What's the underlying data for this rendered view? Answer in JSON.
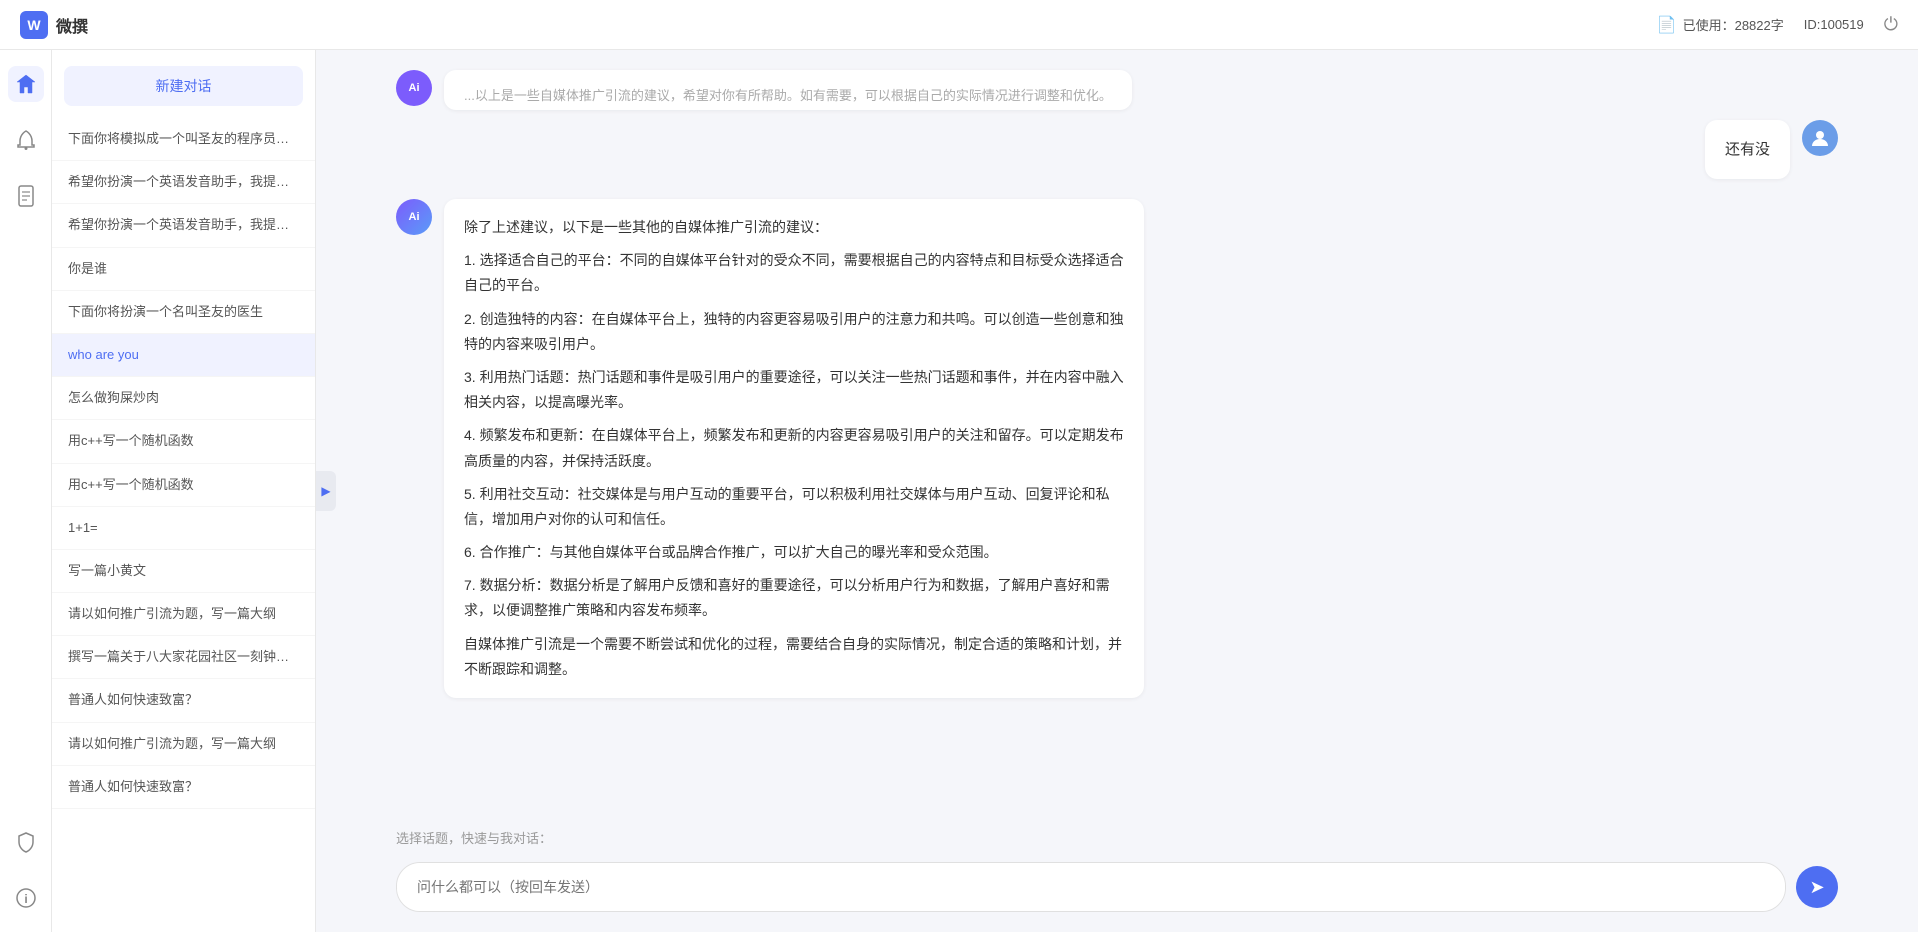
{
  "topbar": {
    "logo_text": "W",
    "title": "微撰",
    "char_label": "已使用：28822字",
    "user_id": "ID:100519",
    "char_icon": "📄"
  },
  "sidebar": {
    "new_chat_label": "新建对话",
    "history": [
      {
        "id": 1,
        "text": "下面你将模拟成一个叫圣友的程序员，我说...",
        "active": false
      },
      {
        "id": 2,
        "text": "希望你扮演一个英语发音助手，我提供给你...",
        "active": false
      },
      {
        "id": 3,
        "text": "希望你扮演一个英语发音助手，我提供给你...",
        "active": false
      },
      {
        "id": 4,
        "text": "你是谁",
        "active": false
      },
      {
        "id": 5,
        "text": "下面你将扮演一个名叫圣友的医生",
        "active": false
      },
      {
        "id": 6,
        "text": "who are you",
        "active": true
      },
      {
        "id": 7,
        "text": "怎么做狗屎炒肉",
        "active": false
      },
      {
        "id": 8,
        "text": "用c++写一个随机函数",
        "active": false
      },
      {
        "id": 9,
        "text": "用c++写一个随机函数",
        "active": false
      },
      {
        "id": 10,
        "text": "1+1=",
        "active": false
      },
      {
        "id": 11,
        "text": "写一篇小黄文",
        "active": false
      },
      {
        "id": 12,
        "text": "请以如何推广引流为题，写一篇大纲",
        "active": false
      },
      {
        "id": 13,
        "text": "撰写一篇关于八大家花园社区一刻钟便民生...",
        "active": false
      },
      {
        "id": 14,
        "text": "普通人如何快速致富？",
        "active": false
      },
      {
        "id": 15,
        "text": "请以如何推广引流为题，写一篇大纲",
        "active": false
      },
      {
        "id": 16,
        "text": "普通人如何快速致富？",
        "active": false
      }
    ],
    "bottom_items": [
      "安全",
      "关于"
    ]
  },
  "icons": {
    "collapse": "▶",
    "nav1": "⬡",
    "nav2": "🔔",
    "nav3": "📝",
    "bottom1": "🔒",
    "bottom2": "ℹ"
  },
  "chat": {
    "messages": [
      {
        "role": "user",
        "text": "还有没",
        "avatar_text": "U"
      },
      {
        "role": "ai",
        "avatar_text": "Ai",
        "paragraphs": [
          "除了上述建议，以下是一些其他的自媒体推广引流的建议：",
          "1. 选择适合自己的平台：不同的自媒体平台针对的受众不同，需要根据自己的内容特点和目标受众选择适合自己的平台。",
          "2. 创造独特的内容：在自媒体平台上，独特的内容更容易吸引用户的注意力和共鸣。可以创造一些创意和独特的内容来吸引用户。",
          "3. 利用热门话题：热门话题和事件是吸引用户的重要途径，可以关注一些热门话题和事件，并在内容中融入相关内容，以提高曝光率。",
          "4. 频繁发布和更新：在自媒体平台上，频繁发布和更新的内容更容易吸引用户的关注和留存。可以定期发布高质量的内容，并保持活跃度。",
          "5. 利用社交互动：社交媒体是与用户互动的重要平台，可以积极利用社交媒体与用户互动、回复评论和私信，增加用户对你的认可和信任。",
          "6. 合作推广：与其他自媒体平台或品牌合作推广，可以扩大自己的曝光率和受众范围。",
          "7. 数据分析：数据分析是了解用户反馈和喜好的重要途径，可以分析用户行为和数据，了解用户喜好和需求，以便调整推广策略和内容发布频率。",
          "自媒体推广引流是一个需要不断尝试和优化的过程，需要结合自身的实际情况，制定合适的策略和计划，并不断跟踪和调整。"
        ]
      }
    ],
    "suggestion_label": "选择话题，快速与我对话：",
    "input_placeholder": "问什么都可以（按回车发送）",
    "send_icon": "➤"
  }
}
